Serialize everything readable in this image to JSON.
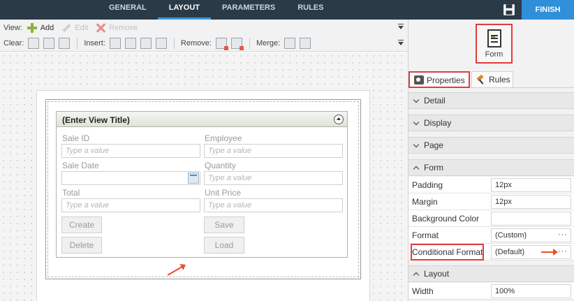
{
  "topnav": {
    "tabs": [
      {
        "label": "GENERAL"
      },
      {
        "label": "LAYOUT"
      },
      {
        "label": "PARAMETERS"
      },
      {
        "label": "RULES"
      }
    ],
    "finish_label": "FINISH"
  },
  "toolbar": {
    "view_label": "View:",
    "add_label": "Add",
    "edit_label": "Edit",
    "remove_view_label": "Remove",
    "clear_label": "Clear:",
    "insert_label": "Insert:",
    "remove_label": "Remove:",
    "merge_label": "Merge:"
  },
  "view": {
    "title": "(Enter View Title)",
    "fields": [
      {
        "label": "Sale ID",
        "placeholder": "Type a value"
      },
      {
        "label": "Employee",
        "placeholder": "Type a value"
      },
      {
        "label": "Sale Date",
        "placeholder": ""
      },
      {
        "label": "Quantity",
        "placeholder": "Type a value"
      },
      {
        "label": "Total",
        "placeholder": "Type a value"
      },
      {
        "label": "Unit Price",
        "placeholder": "Type a value"
      }
    ],
    "buttons": {
      "create": "Create",
      "save": "Save",
      "delete": "Delete",
      "load": "Load"
    }
  },
  "panel": {
    "form_type_label": "Form",
    "tabs": {
      "properties": "Properties",
      "rules": "Rules"
    },
    "sections": {
      "detail": "Detail",
      "display": "Display",
      "page": "Page",
      "form": "Form",
      "layout": "Layout"
    },
    "properties": [
      {
        "name": "Padding",
        "value": "12px"
      },
      {
        "name": "Margin",
        "value": "12px"
      },
      {
        "name": "Background Color",
        "value": ""
      },
      {
        "name": "Format",
        "value": "(Custom)"
      },
      {
        "name": "Conditional Format",
        "value": "(Default)"
      }
    ],
    "layout_props": [
      {
        "name": "Width",
        "value": "100%"
      }
    ],
    "ellipsis": "···"
  },
  "colors": {
    "accent": "#2f8fd8",
    "highlight": "#e03c3c",
    "arrow": "#e8502d",
    "topbar": "#2b3a47"
  }
}
